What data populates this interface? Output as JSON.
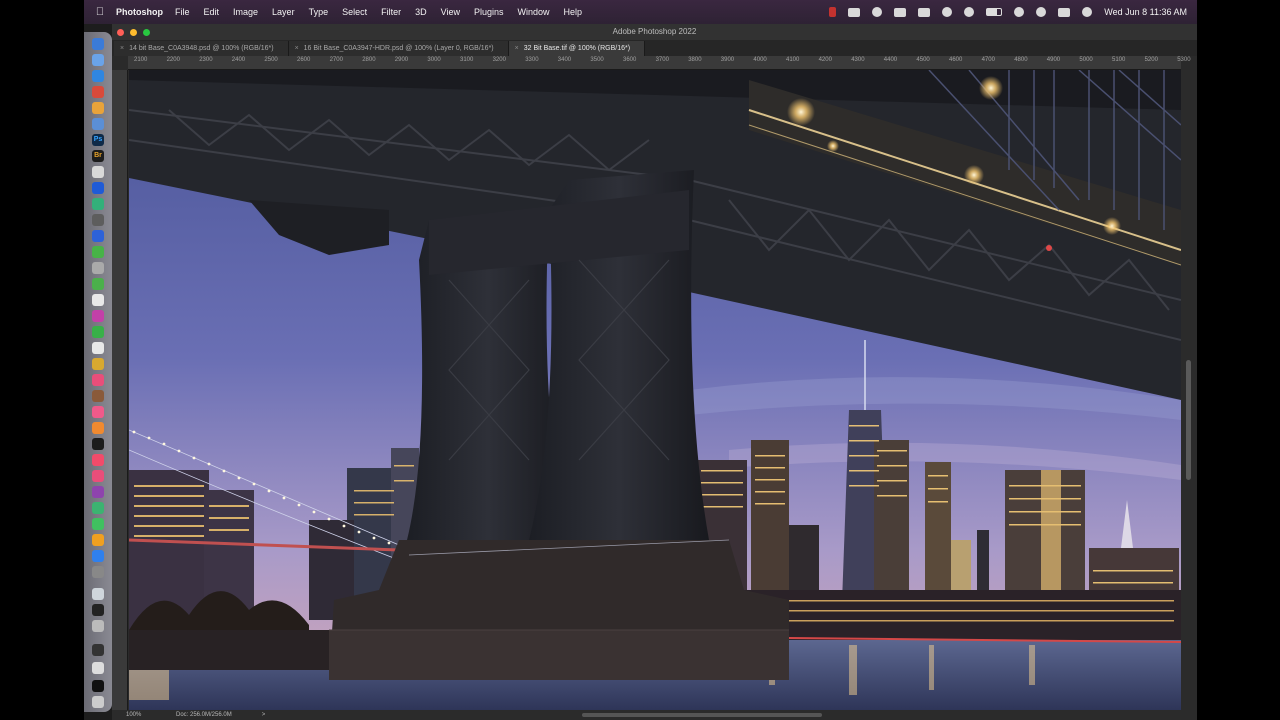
{
  "menubar": {
    "app_name": "Photoshop",
    "menus": [
      "File",
      "Edit",
      "Image",
      "Layer",
      "Type",
      "Select",
      "Filter",
      "3D",
      "View",
      "Plugins",
      "Window",
      "Help"
    ],
    "clock": "Wed Jun 8  11:36 AM"
  },
  "window": {
    "title": "Adobe Photoshop 2022"
  },
  "tabs": [
    {
      "label": "14 bit Base_C0A3948.psd @ 100% (RGB/16*)",
      "active": false
    },
    {
      "label": "16 Bit Base_C0A3947-HDR.psd @ 100% (Layer 0, RGB/16*)",
      "active": false
    },
    {
      "label": "32 Bit Base.tif @ 100% (RGB/16*)",
      "active": true
    }
  ],
  "ruler": {
    "ticks": [
      "2100",
      "2200",
      "2300",
      "2400",
      "2500",
      "2600",
      "2700",
      "2800",
      "2900",
      "3000",
      "3100",
      "3200",
      "3300",
      "3400",
      "3500",
      "3600",
      "3700",
      "3800",
      "3900",
      "4000",
      "4100",
      "4200",
      "4300",
      "4400",
      "4500",
      "4600",
      "4700",
      "4800",
      "4900",
      "5000",
      "5100",
      "5200",
      "5300"
    ]
  },
  "status": {
    "zoom": "100%",
    "doc_size": "Doc: 256.0M/256.0M",
    "arrow": ">"
  },
  "colors": {
    "menubar_bg": "#2e2234",
    "ps_chrome": "#2a2a2a",
    "canvas_sky_top": "#4e5a9e",
    "canvas_sky_horizon": "#c8a8c8",
    "bridge_steel": "#22252b",
    "city_lights": "#f6c870"
  }
}
